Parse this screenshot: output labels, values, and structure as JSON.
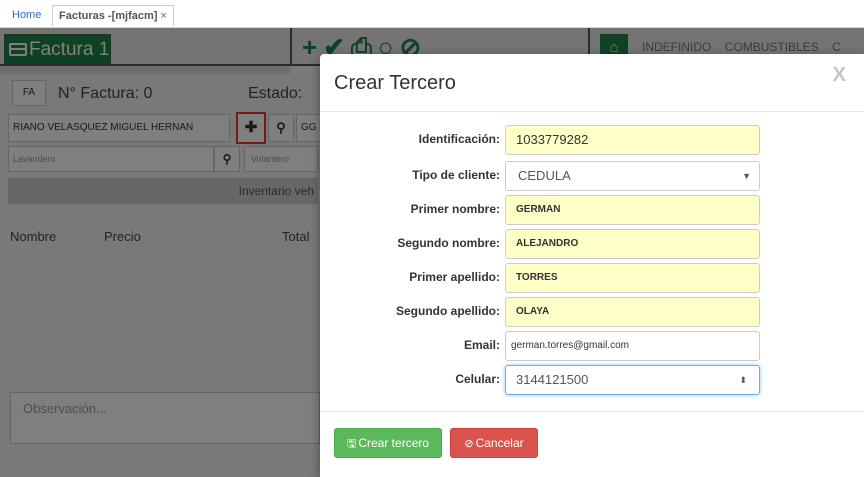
{
  "tabs": {
    "home": "Home",
    "active": "Facturas -[mjfacm]",
    "close": "×"
  },
  "app": {
    "factura_title": "Factura 1",
    "categories": [
      "INDEFINIDO",
      "COMBUSTIBLES",
      "C"
    ],
    "fa_label": "FA",
    "factura_number": "N° Factura: 0",
    "estado_label": "Estado:",
    "cliente_value": "RIANO VELASQUEZ MIGUEL HERNAN",
    "gc_value": "GG",
    "lavandero_placeholder": "Lavandero",
    "volantero_placeholder": "Volantero",
    "inventario_label": "Inventario veh",
    "columns": [
      "Nombre",
      "Precio",
      "Total"
    ],
    "observacion_placeholder": "Observación..."
  },
  "modal": {
    "title": "Crear Tercero",
    "close": "X",
    "fields": {
      "identificacion": {
        "label": "Identificación:",
        "value": "1033779282"
      },
      "tipo_cliente": {
        "label": "Tipo de cliente:",
        "value": "CEDULA"
      },
      "primer_nombre": {
        "label": "Primer nombre:",
        "value": "GERMAN"
      },
      "segundo_nombre": {
        "label": "Segundo nombre:",
        "value": "ALEJANDRO"
      },
      "primer_apellido": {
        "label": "Primer apellido:",
        "value": "TORRES"
      },
      "segundo_apellido": {
        "label": "Segundo apellido:",
        "value": "OLAYA"
      },
      "email": {
        "label": "Email:",
        "value": "german.torres@gmail.com"
      },
      "celular": {
        "label": "Celular:",
        "value": "3144121500"
      }
    },
    "buttons": {
      "create": "Crear tercero",
      "cancel": "Cancelar"
    }
  },
  "colors": {
    "brand_green": "#1e8449",
    "success": "#5cb85c",
    "danger": "#d9534f",
    "highlight_field": "#ffffc8"
  }
}
